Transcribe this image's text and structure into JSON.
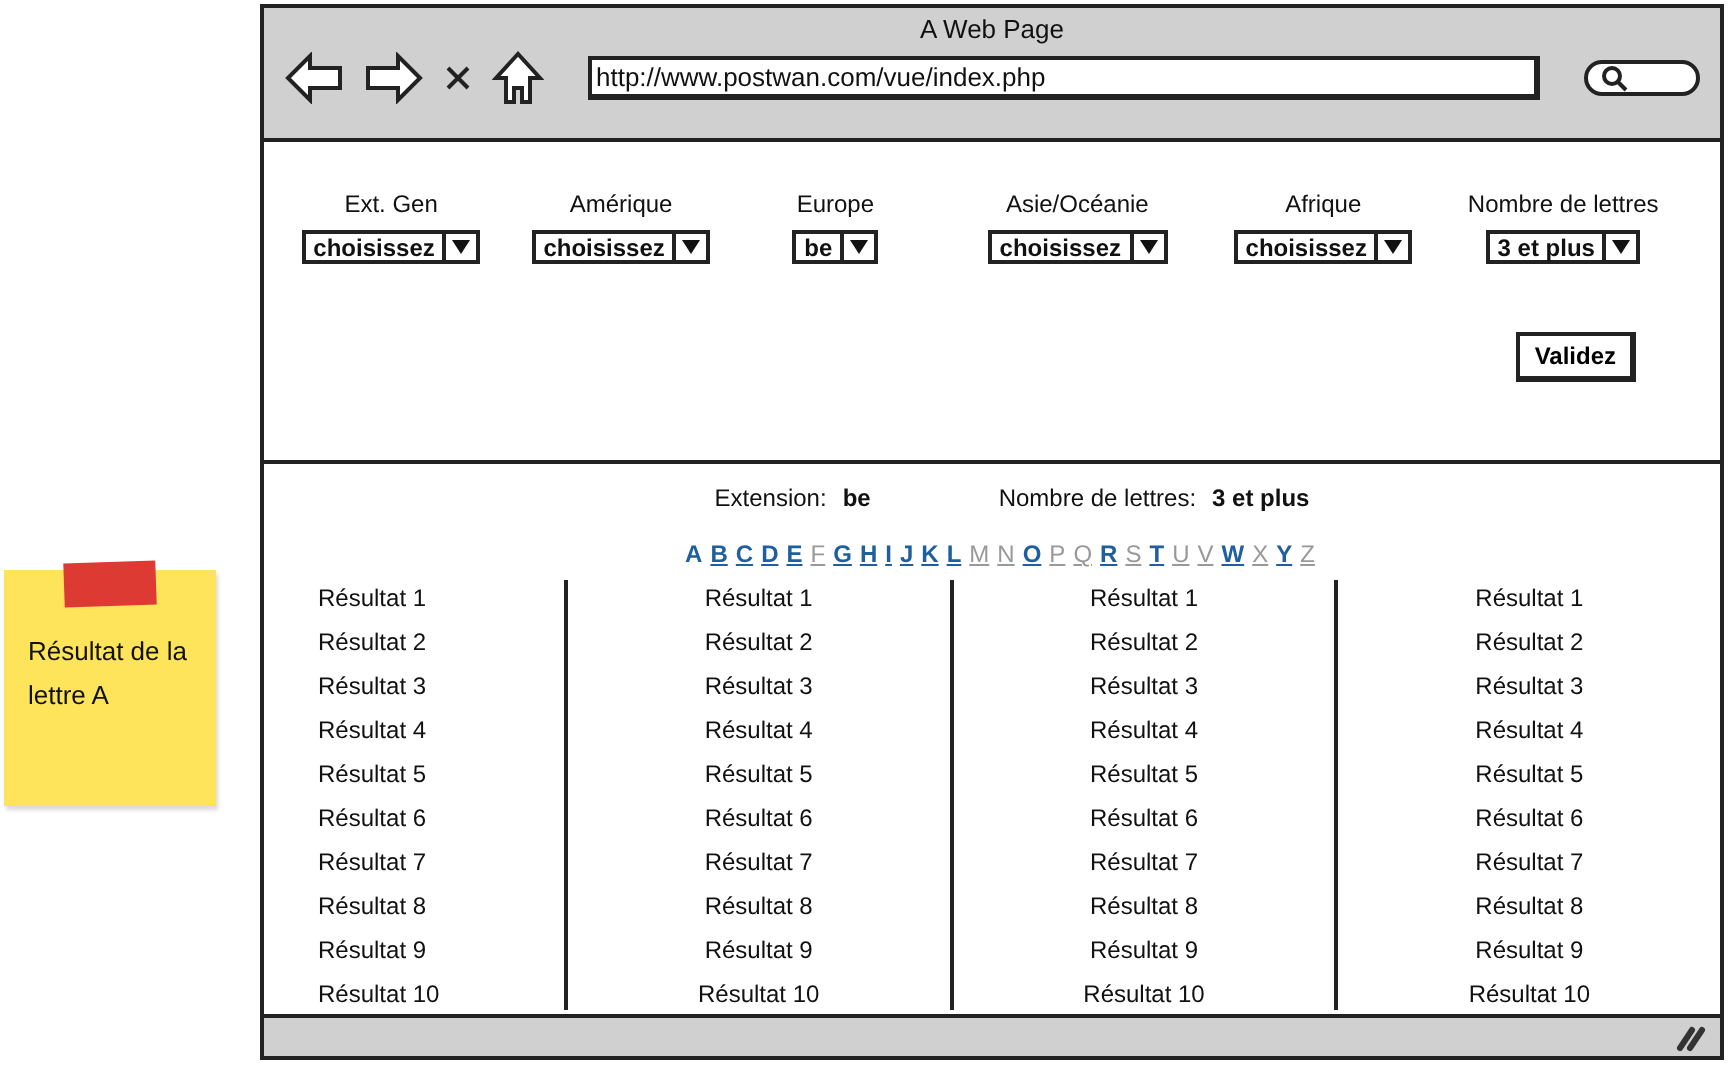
{
  "sticky_note": {
    "text": "Résultat de la lettre A"
  },
  "window": {
    "title": "A Web Page"
  },
  "address_bar": {
    "value": "http://www.postwan.com/vue/index.php"
  },
  "filters": [
    {
      "label": "Ext. Gen",
      "value": "choisissez"
    },
    {
      "label": "Amérique",
      "value": "choisissez"
    },
    {
      "label": "Europe",
      "value": "be"
    },
    {
      "label": "Asie/Océanie",
      "value": "choisissez"
    },
    {
      "label": "Afrique",
      "value": "choisissez"
    },
    {
      "label": "Nombre de lettres",
      "value": "3 et plus"
    }
  ],
  "submit_button": "Validez",
  "summary": [
    {
      "label": "Extension:",
      "value": "be"
    },
    {
      "label": "Nombre de lettres:",
      "value": "3 et plus"
    }
  ],
  "letters": [
    {
      "letter": "A",
      "selected": true,
      "disabled": false
    },
    {
      "letter": "B",
      "selected": false,
      "disabled": false
    },
    {
      "letter": "C",
      "selected": false,
      "disabled": false
    },
    {
      "letter": "D",
      "selected": false,
      "disabled": false
    },
    {
      "letter": "E",
      "selected": false,
      "disabled": false
    },
    {
      "letter": "F",
      "selected": false,
      "disabled": true
    },
    {
      "letter": "G",
      "selected": false,
      "disabled": false
    },
    {
      "letter": "H",
      "selected": false,
      "disabled": false
    },
    {
      "letter": "I",
      "selected": false,
      "disabled": false
    },
    {
      "letter": "J",
      "selected": false,
      "disabled": false
    },
    {
      "letter": "K",
      "selected": false,
      "disabled": false
    },
    {
      "letter": "L",
      "selected": false,
      "disabled": false
    },
    {
      "letter": "M",
      "selected": false,
      "disabled": true
    },
    {
      "letter": "N",
      "selected": false,
      "disabled": true
    },
    {
      "letter": "O",
      "selected": false,
      "disabled": false
    },
    {
      "letter": "P",
      "selected": false,
      "disabled": true
    },
    {
      "letter": "Q",
      "selected": false,
      "disabled": true
    },
    {
      "letter": "R",
      "selected": false,
      "disabled": false
    },
    {
      "letter": "S",
      "selected": false,
      "disabled": true
    },
    {
      "letter": "T",
      "selected": false,
      "disabled": false
    },
    {
      "letter": "U",
      "selected": false,
      "disabled": true
    },
    {
      "letter": "V",
      "selected": false,
      "disabled": true
    },
    {
      "letter": "W",
      "selected": false,
      "disabled": false
    },
    {
      "letter": "X",
      "selected": false,
      "disabled": true
    },
    {
      "letter": "Y",
      "selected": false,
      "disabled": false
    },
    {
      "letter": "Z",
      "selected": false,
      "disabled": true
    }
  ],
  "result_columns": [
    [
      "Résultat 1",
      "Résultat 2",
      "Résultat 3",
      "Résultat 4",
      "Résultat 5",
      "Résultat 6",
      "Résultat 7",
      "Résultat 8",
      "Résultat 9",
      "Résultat 10"
    ],
    [
      "Résultat 1",
      "Résultat 2",
      "Résultat 3",
      "Résultat 4",
      "Résultat 5",
      "Résultat 6",
      "Résultat 7",
      "Résultat 8",
      "Résultat 9",
      "Résultat 10"
    ],
    [
      "Résultat 1",
      "Résultat 2",
      "Résultat 3",
      "Résultat 4",
      "Résultat 5",
      "Résultat 6",
      "Résultat 7",
      "Résultat 8",
      "Résultat 9",
      "Résultat 10"
    ],
    [
      "Résultat 1",
      "Résultat 2",
      "Résultat 3",
      "Résultat 4",
      "Résultat 5",
      "Résultat 6",
      "Résultat 7",
      "Résultat 8",
      "Résultat 9",
      "Résultat 10"
    ]
  ]
}
